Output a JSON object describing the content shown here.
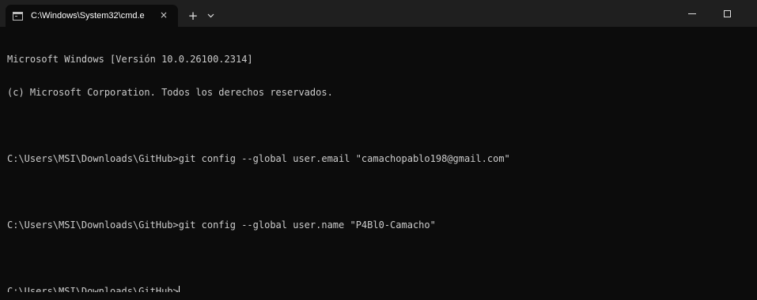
{
  "window": {
    "tab_title": "C:\\Windows\\System32\\cmd.e",
    "tab_close": "×",
    "new_tab": "+"
  },
  "icons": {
    "tab": "terminal-icon",
    "close": "close-icon",
    "new_tab": "plus-icon",
    "dropdown": "chevron-down-icon",
    "minimize": "minimize-icon",
    "maximize": "maximize-icon",
    "window_close": "window-close-icon"
  },
  "console": {
    "header_line_1": "Microsoft Windows [Versión 10.0.26100.2314]",
    "header_line_2": "(c) Microsoft Corporation. Todos los derechos reservados.",
    "command_1": "C:\\Users\\MSI\\Downloads\\GitHub>git config --global user.email \"camachopablo198@gmail.com\"",
    "command_2": "C:\\Users\\MSI\\Downloads\\GitHub>git config --global user.name \"P4Bl0-Camacho\"",
    "prompt": "C:\\Users\\MSI\\Downloads\\GitHub>"
  },
  "colors": {
    "background": "#0c0c0c",
    "titlebar": "#1f1f1f",
    "text": "#cccccc"
  }
}
